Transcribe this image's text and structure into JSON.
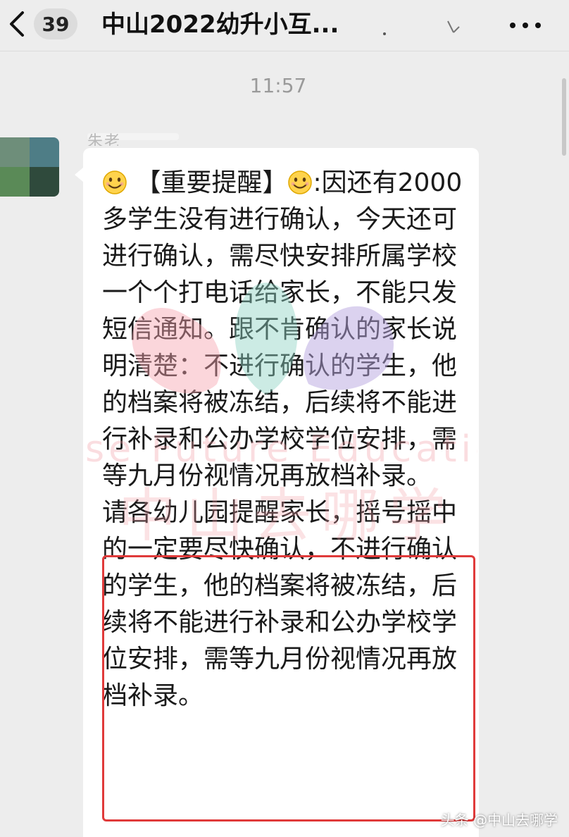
{
  "navbar": {
    "badge_count": "39",
    "title": "中山2022幼升小互..."
  },
  "chat": {
    "timestamp": "11:57",
    "sender_name": "朱老",
    "message": {
      "emoji_1": "smile-emoji",
      "tag": "【重要提醒】",
      "emoji_2": "smile-emoji",
      "colon": ":",
      "paragraph_1": "因还有2000多学生没有进行确认，今天还可进行确认，需尽快安排所属学校一个个打电话给家长，不能只发短信通知。跟不肯确认的家长说明清楚：不进行确认的学生，他的档案将被冻结，后续将不能进行补录和公办学校学位安排，需等九月份视情况再放档补录。",
      "paragraph_2": "请各幼儿园提醒家长，摇号摇中的一定要尽快确认，不进行确认的学生，他的档案将被冻结，后续将不能进行补录和公办学校学位安排，需等九月份视情况再放档补录。"
    }
  },
  "watermark": {
    "line_1": "Wise Future Education",
    "line_2": "中山去哪学"
  },
  "source_mark": "头条 @中山去哪学",
  "colors": {
    "background": "#ededed",
    "bubble": "#ffffff",
    "highlight_border": "#e03a3a",
    "text": "#1a1a1a",
    "timestamp": "#9a9a9a"
  }
}
